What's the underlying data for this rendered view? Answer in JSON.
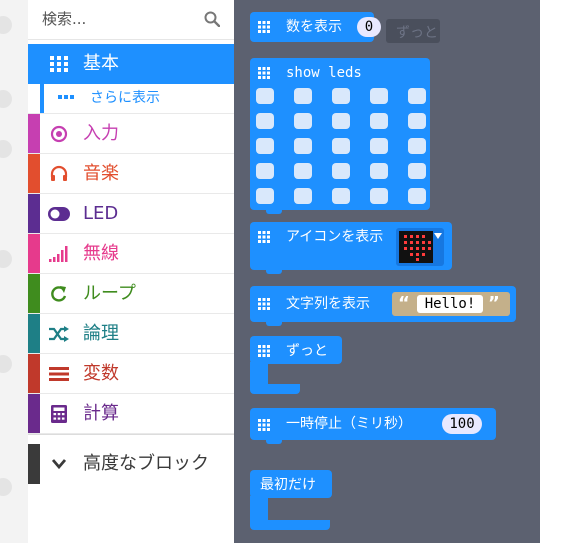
{
  "search": {
    "placeholder": "検索..."
  },
  "categories": [
    {
      "label": "基本",
      "color": "#1e90ff",
      "icon": "grid-icon"
    },
    {
      "label": "さらに表示",
      "color": "#1e90ff",
      "icon": "more-dots-icon"
    },
    {
      "label": "入力",
      "color": "#c63fb1",
      "icon": "target-icon"
    },
    {
      "label": "音楽",
      "color": "#e24e2e",
      "icon": "headphones-icon"
    },
    {
      "label": "LED",
      "color": "#5c2d91",
      "icon": "toggle-icon"
    },
    {
      "label": "無線",
      "color": "#e63a8c",
      "icon": "signal-bars-icon"
    },
    {
      "label": "ループ",
      "color": "#3f8c1e",
      "icon": "loop-arrow-icon"
    },
    {
      "label": "論理",
      "color": "#1e7f86",
      "icon": "shuffle-icon"
    },
    {
      "label": "変数",
      "color": "#c0392b",
      "icon": "lines-icon"
    },
    {
      "label": "計算",
      "color": "#6a2a8c",
      "icon": "calculator-icon"
    },
    {
      "label": "高度なブロック",
      "color": "#3a3a3a",
      "icon": "chevron-down-icon"
    }
  ],
  "blocks": {
    "show_number": {
      "label": "数を表示",
      "value": "0"
    },
    "forever_ghost": {
      "label": "ずっと"
    },
    "show_leds": {
      "label": "show leds"
    },
    "show_icon": {
      "label": "アイコンを表示"
    },
    "show_string": {
      "label": "文字列を表示",
      "value": "Hello!",
      "open_quote": "“",
      "close_quote": "”"
    },
    "forever": {
      "label": "ずっと"
    },
    "pause": {
      "label": "一時停止（ミリ秒）",
      "value": "100"
    },
    "on_start": {
      "label": "最初だけ"
    }
  }
}
